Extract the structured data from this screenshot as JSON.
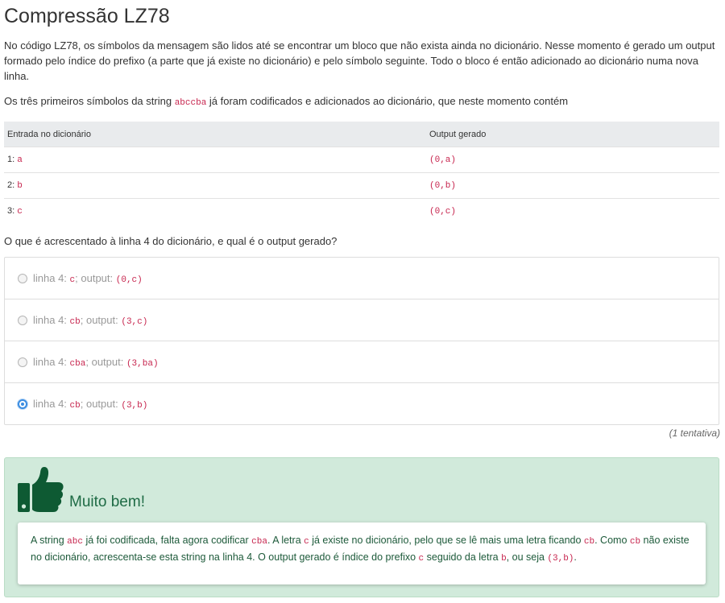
{
  "title": "Compressão LZ78",
  "intro": "No código LZ78, os símbolos da mensagem são lidos até se encontrar um bloco que não exista ainda no dicionário. Nesse momento é gerado um output formado pelo índice do prefixo (a parte que já existe no dicionário) e pelo símbolo seguinte. Todo o bloco é então adicionado ao dicionário numa nova linha.",
  "lead": {
    "before": "Os três primeiros símbolos da string ",
    "code": "abccba",
    "after": " já foram codificados e adicionados ao dicionário, que neste momento contém"
  },
  "table": {
    "headers": [
      "Entrada no dicionário",
      "Output gerado"
    ],
    "rows": [
      {
        "index": "1:",
        "entry": "a",
        "output": "(0,a)"
      },
      {
        "index": "2:",
        "entry": "b",
        "output": "(0,b)"
      },
      {
        "index": "3:",
        "entry": "c",
        "output": "(0,c)"
      }
    ]
  },
  "question": "O que é acrescentado à linha 4 do dicionário, e qual é o output gerado?",
  "options": [
    {
      "prefix": "linha 4: ",
      "entry": "c",
      "middle": "; output: ",
      "output": "(0,c)",
      "selected": false
    },
    {
      "prefix": "linha 4: ",
      "entry": "cb",
      "middle": "; output: ",
      "output": "(3,c)",
      "selected": false
    },
    {
      "prefix": "linha 4: ",
      "entry": "cba",
      "middle": "; output: ",
      "output": "(3,ba)",
      "selected": false
    },
    {
      "prefix": "linha 4: ",
      "entry": "cb",
      "middle": "; output: ",
      "output": "(3,b)",
      "selected": true
    }
  ],
  "attempts": "(1 tentativa)",
  "feedback": {
    "icon": "thumbs-up-icon",
    "title": "Muito bem!",
    "parts": [
      {
        "t": "A string ",
        "code": false
      },
      {
        "t": "abc",
        "code": true
      },
      {
        "t": " já foi codificada, falta agora codificar ",
        "code": false
      },
      {
        "t": "cba",
        "code": true
      },
      {
        "t": ". A letra ",
        "code": false
      },
      {
        "t": "c",
        "code": true
      },
      {
        "t": " já existe no dicionário, pelo que se lê mais uma letra ficando ",
        "code": false
      },
      {
        "t": "cb",
        "code": true
      },
      {
        "t": ". Como ",
        "code": false
      },
      {
        "t": "cb",
        "code": true
      },
      {
        "t": " não existe no dicionário, acrescenta-se esta string na linha 4. O output gerado é índice do prefixo ",
        "code": false
      },
      {
        "t": "c",
        "code": true
      },
      {
        "t": " seguido da letra ",
        "code": false
      },
      {
        "t": "b",
        "code": true
      },
      {
        "t": ", ou seja ",
        "code": false
      },
      {
        "t": "(3,b)",
        "code": true
      },
      {
        "t": ".",
        "code": false
      }
    ]
  },
  "colors": {
    "code": "#c7254e",
    "feedback_bg": "#d1eadb",
    "feedback_text": "#1e6b45",
    "radio_selected": "#3b8de1"
  }
}
